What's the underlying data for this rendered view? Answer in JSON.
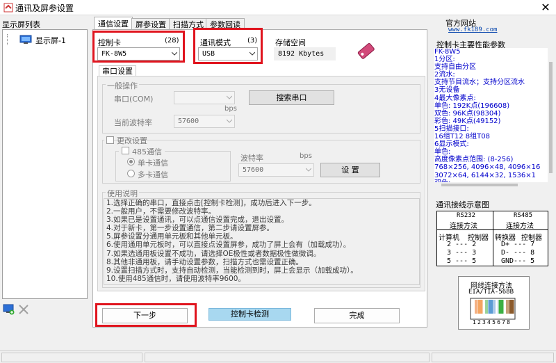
{
  "window": {
    "title": "通讯及屏参设置",
    "close_glyph": "✕"
  },
  "left": {
    "list_title": "显示屏列表",
    "items": [
      {
        "label": "显示屏-1"
      }
    ]
  },
  "tabs": [
    {
      "label": "通信设置"
    },
    {
      "label": "屏参设置"
    },
    {
      "label": "扫描方式"
    },
    {
      "label": "参数回读"
    }
  ],
  "comm": {
    "card": {
      "label": "控制卡",
      "count": "(28)",
      "value": "FK-8W5"
    },
    "mode": {
      "label": "通讯模式",
      "count": "(3)",
      "value": "USB"
    },
    "storage": {
      "label": "存储空间",
      "value": "8192 Kbytes"
    }
  },
  "serial": {
    "tab_label": "串口设置",
    "general_label": "一般操作",
    "port_label": "串口(COM)",
    "port_value": "",
    "search_button": "搜索串口",
    "bps_unit": "bps",
    "baud_label": "当前波特率",
    "baud_value": "57600",
    "change_label": "更改设置",
    "rs485_label": "485通信",
    "single_label": "单卡通信",
    "multi_label": "多卡通信",
    "rate_label": "波特率",
    "rate_unit": "bps",
    "rate_value": "57600",
    "set_button": "设 置"
  },
  "usage": {
    "title": "使用说明",
    "lines": [
      "1.选择正确的串口，直接点击[控制卡检测]，成功后进入下一步。",
      "2.一般用户，不需要修改波特率。",
      "3.如果已是设置通讯，可以点通信设置完成，退出设置。",
      "4.对于新卡，第一步设置通信，第二步请设置屏参。",
      "5.屏参设置分通用单元板和其他单元板。",
      "6.使用通用单元板时，可以直接点设置屏参，成功了屏上会有（加载成功）。",
      "7.如果选通用板设置不成功，请选择OE极性或者数据极性做微调。",
      "8.其他非通用板，请手动设置参数，扫描方式也需设置正确。",
      "9.设置扫描方式时，支持自动检测，当能检测到时，屏上会显示（加载成功）。",
      "10.使用485通信时，请使用波特率9600。"
    ]
  },
  "buttons": {
    "next": "下一步",
    "detect": "控制卡检测",
    "finish": "完成"
  },
  "right": {
    "site_title": "官方网站",
    "url": "www.fk189.com",
    "perf_title": "控制卡主要性能参数",
    "perf_lines": [
      "FK-8W5",
      "1分区:",
      "   支持自由分区",
      "2流水:",
      "   支持节目流水；支持分区流水",
      "3无设备",
      "4最大像素点:",
      "   单色: 192K点(196608)",
      "   双色: 96K点(98304)",
      "   彩色: 49K点(49152)",
      "5扫描接口:",
      "   16组T12  8组T08",
      "6显示模式:",
      "   单色:",
      "   高度像素点范围: (8-256)",
      " 768×256, 4096×48, 4096×16",
      "   3072×64, 6144×32, 1536×1",
      "   双色:"
    ],
    "wiring_title": "通讯接线示意图",
    "rs232": {
      "title": "RS232",
      "method": "连接方法",
      "col1": "计算机",
      "col2": "控制器",
      "rows": [
        "2 --- 2",
        "3 --- 3",
        "5 --- 5"
      ]
    },
    "rs485": {
      "title": "RS485",
      "method": "连接方法",
      "col1": "转换器",
      "col2": "控制器",
      "rows": [
        "D+ --- 7",
        "D- --- 8",
        "GND--- 5"
      ]
    },
    "net_title": "网线连接方法",
    "net_std": "EIA/TIA-568B",
    "pins": "12345678"
  },
  "colors": {
    "red_highlight": "#e0141e",
    "perf_text": "#0000cc",
    "detect_button": "#a8d8f0"
  }
}
